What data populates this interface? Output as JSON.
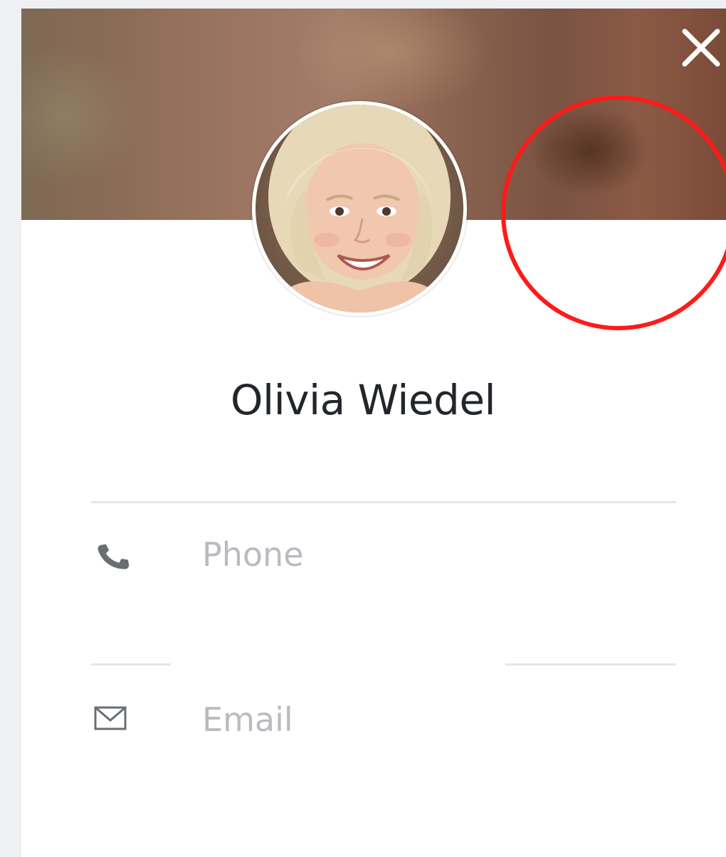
{
  "contact": {
    "name": "Olivia Wiedel",
    "avatar_alt": "profile-photo"
  },
  "fields": {
    "phone": {
      "label": "Phone",
      "icon": "phone-icon"
    },
    "email": {
      "label": "Email",
      "icon": "envelope-icon"
    }
  },
  "controls": {
    "close_icon": "close-icon"
  },
  "colors": {
    "annotation": "#ff1a1a",
    "name_text": "#22262b",
    "placeholder_text": "#b8bbc0",
    "divider": "#e4e6ea"
  }
}
